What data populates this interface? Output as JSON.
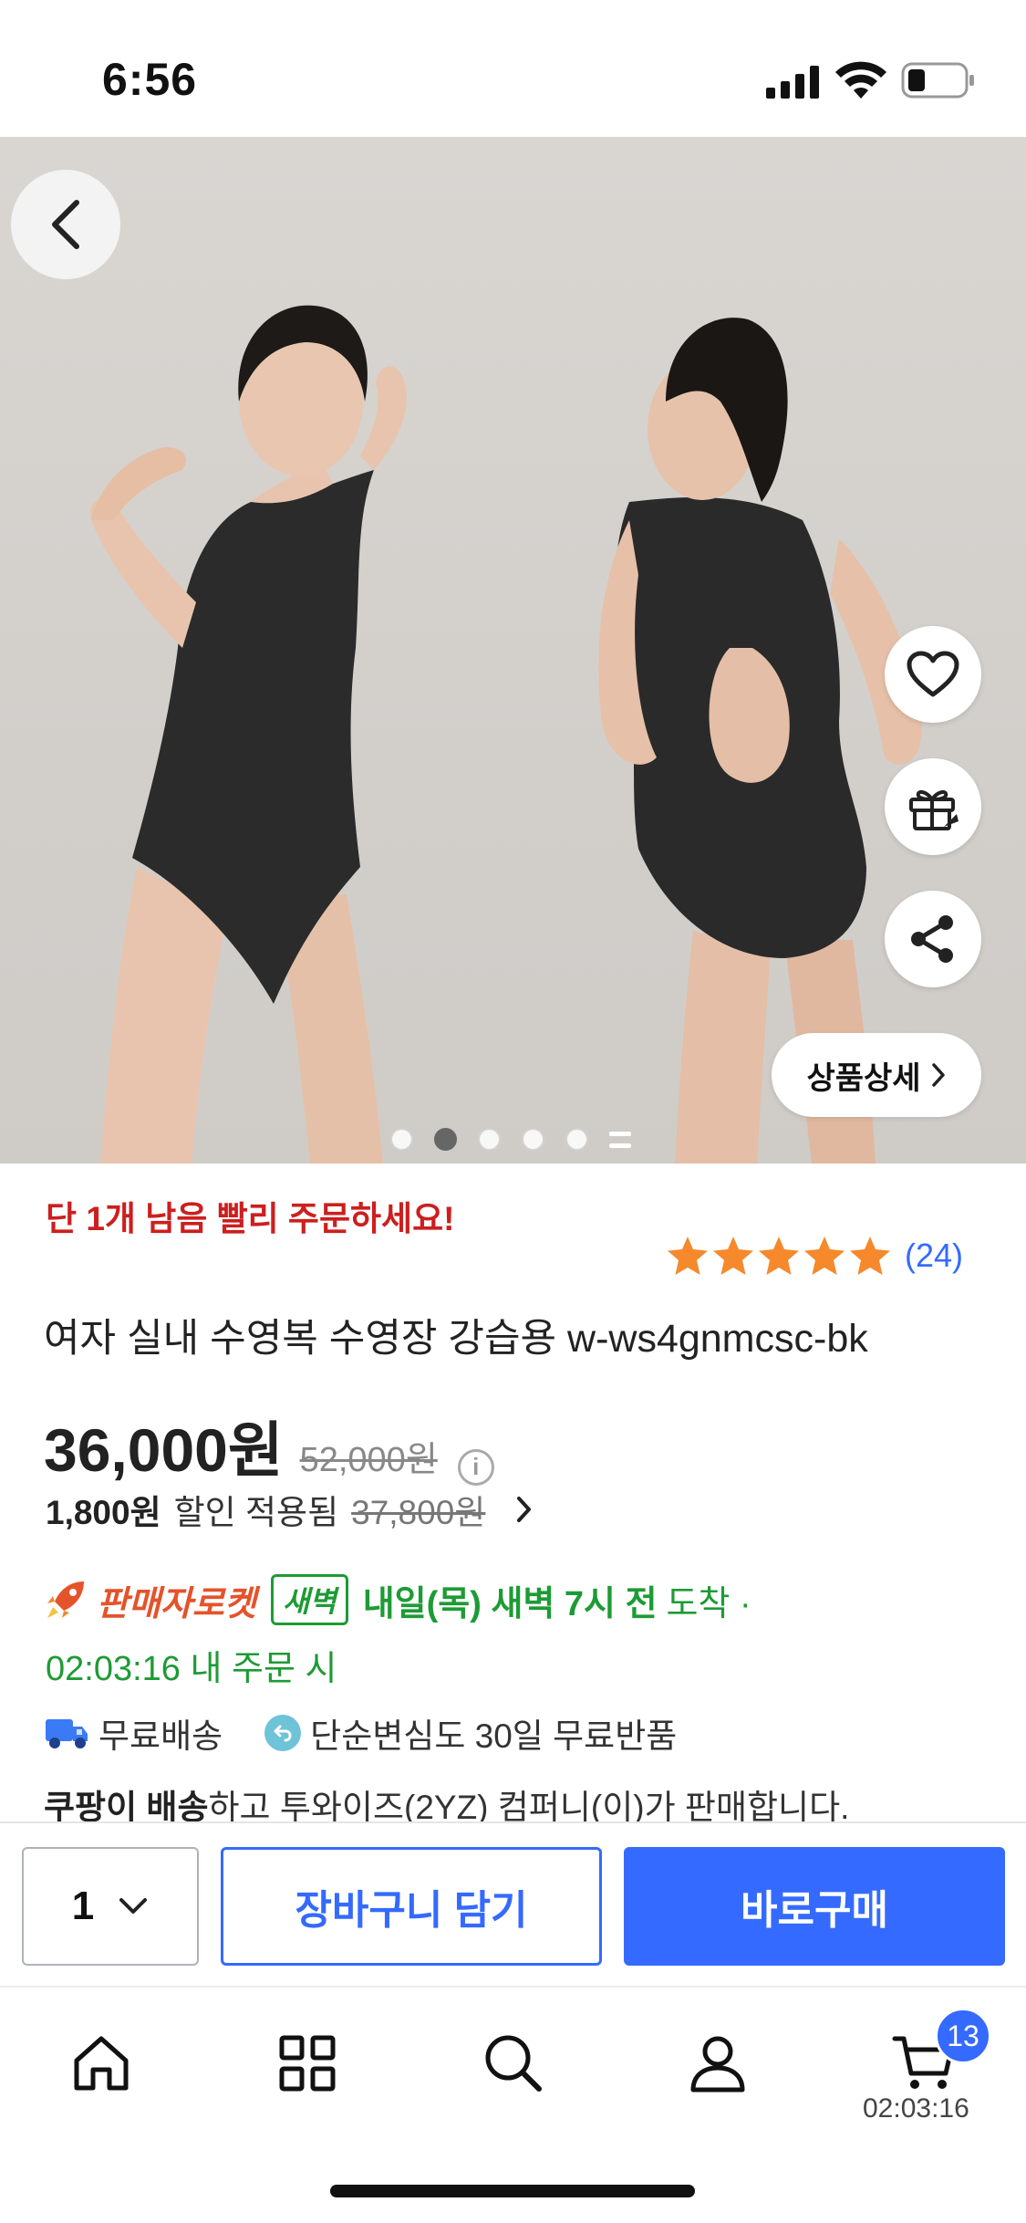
{
  "status_bar": {
    "time": "6:56"
  },
  "hero": {
    "detail_button_label": "상품상세",
    "image_count": 6,
    "active_image_index": 1
  },
  "product": {
    "urgency_text": "단 1개 남음 빨리 주문하세요!",
    "rating_stars": 5,
    "review_count": "(24)",
    "title": "여자 실내 수영복 수영장 강습용 w-ws4gnmcsc-bk",
    "price": "36,000원",
    "original_price": "52,000원",
    "discount_amount": "1,800원",
    "discount_text": "할인 적용됨",
    "discounted_from": "37,800원"
  },
  "delivery": {
    "rocket_label": "판매자로켓",
    "dawn_badge": "새벽",
    "arrival_bold": "내일(목) 새벽 7시 전",
    "arrival_suffix": "도착 ·",
    "order_deadline": "02:03:16 내 주문 시",
    "free_shipping": "무료배송",
    "free_return": "단순변심도 30일 무료반품",
    "seller_bold": "쿠팡이 배송",
    "seller_rest": "하고 투와이즈(2YZ) 컴퍼니(이)가 판매합니다."
  },
  "actions": {
    "quantity": "1",
    "add_to_cart": "장바구니 담기",
    "buy_now": "바로구매"
  },
  "tab_bar": {
    "cart_badge": "13",
    "cart_timer": "02:03:16"
  },
  "colors": {
    "accent_blue": "#346aff",
    "urgency_red": "#cc1f1f",
    "delivery_green": "#1d9b34",
    "star_orange": "#f5892b",
    "rocket_orange": "#e4532a"
  }
}
